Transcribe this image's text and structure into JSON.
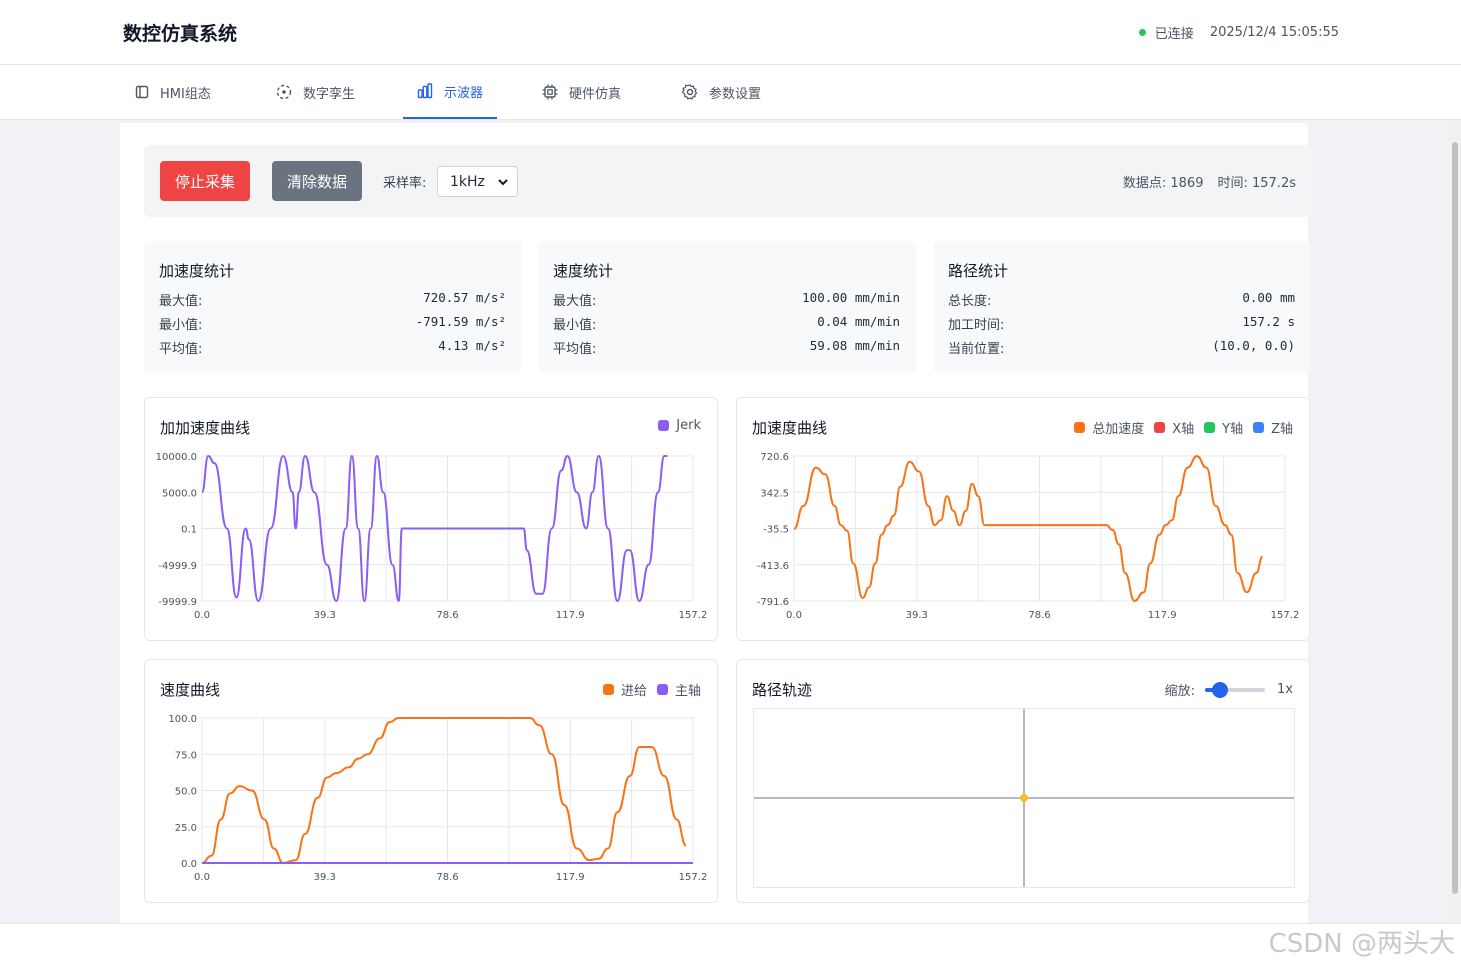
{
  "app": {
    "title": "数控仿真系统",
    "status_text": "已连接",
    "datetime": "2025/12/4 15:05:55",
    "status_color": "#22c55e"
  },
  "tabs": [
    {
      "label": "HMI组态",
      "icon": "panel-icon",
      "active": false
    },
    {
      "label": "数字孪生",
      "icon": "twin-icon",
      "active": false
    },
    {
      "label": "示波器",
      "icon": "bar-chart-icon",
      "active": true
    },
    {
      "label": "硬件仿真",
      "icon": "chip-icon",
      "active": false
    },
    {
      "label": "参数设置",
      "icon": "gear-icon",
      "active": false
    }
  ],
  "toolbar": {
    "stop_label": "停止采集",
    "clear_label": "清除数据",
    "rate_label": "采样率:",
    "rate_value": "1kHz",
    "points_text": "数据点: 1869",
    "time_text": "时间: 157.2s"
  },
  "stats": {
    "accel": {
      "title": "加速度统计",
      "rows": [
        {
          "label": "最大值:",
          "value": "720.57 m/s²"
        },
        {
          "label": "最小值:",
          "value": "-791.59 m/s²"
        },
        {
          "label": "平均值:",
          "value": "4.13 m/s²"
        }
      ]
    },
    "speed": {
      "title": "速度统计",
      "rows": [
        {
          "label": "最大值:",
          "value": "100.00 mm/min"
        },
        {
          "label": "最小值:",
          "value": "0.04 mm/min"
        },
        {
          "label": "平均值:",
          "value": "59.08 mm/min"
        }
      ]
    },
    "path": {
      "title": "路径统计",
      "rows": [
        {
          "label": "总长度:",
          "value": "0.00 mm"
        },
        {
          "label": "加工时间:",
          "value": "157.2 s"
        },
        {
          "label": "当前位置:",
          "value": "(10.0, 0.0)"
        }
      ]
    }
  },
  "path_panel": {
    "title": "路径轨迹",
    "zoom_label": "缩放:",
    "zoom_value": "1x",
    "zoom_level": 0.25,
    "point_color": "#fbbf24"
  },
  "watermark": "CSDN @两头大",
  "chart_data": [
    {
      "title": "加加速度曲线",
      "type": "line",
      "xticks": [
        "0.0",
        "39.3",
        "78.6",
        "117.9",
        "157.2"
      ],
      "yticks": [
        "10000.0",
        "5000.0",
        "0.1",
        "-4999.9",
        "-9999.9"
      ],
      "xlim": [
        0,
        157.2
      ],
      "ylim": [
        -9999.9,
        10000.0
      ],
      "series": [
        {
          "name": "Jerk",
          "color": "#8b5cf6",
          "points": [
            [
              0,
              5000
            ],
            [
              2,
              10000
            ],
            [
              4,
              9000
            ],
            [
              8,
              0
            ],
            [
              11,
              -9500
            ],
            [
              14,
              0
            ],
            [
              15,
              -1500
            ],
            [
              18,
              -9999
            ],
            [
              22,
              0
            ],
            [
              26,
              10000
            ],
            [
              29,
              5000
            ],
            [
              30,
              0
            ],
            [
              31,
              5000
            ],
            [
              33,
              10000
            ],
            [
              36,
              5000
            ],
            [
              40,
              -5000
            ],
            [
              43,
              -9999
            ],
            [
              46,
              0
            ],
            [
              48,
              10000
            ],
            [
              50,
              0
            ],
            [
              52,
              -9999
            ],
            [
              54,
              0
            ],
            [
              56,
              10000
            ],
            [
              58,
              5000
            ],
            [
              61,
              -5000
            ],
            [
              63,
              -9999
            ],
            [
              64,
              0
            ],
            [
              64.5,
              0
            ],
            [
              103,
              0
            ],
            [
              104,
              -3000
            ],
            [
              107,
              -9000
            ],
            [
              109,
              -9000
            ],
            [
              112,
              0
            ],
            [
              115,
              8000
            ],
            [
              117,
              10000
            ],
            [
              120,
              5000
            ],
            [
              123,
              0
            ],
            [
              125,
              5000
            ],
            [
              127,
              10000
            ],
            [
              130,
              0
            ],
            [
              133,
              -9999
            ],
            [
              136,
              -3000
            ],
            [
              137,
              -3000
            ],
            [
              140,
              -9999
            ],
            [
              143,
              -5000
            ],
            [
              146,
              5000
            ],
            [
              148,
              9999
            ],
            [
              149,
              9999
            ]
          ]
        }
      ]
    },
    {
      "title": "加速度曲线",
      "type": "line",
      "xticks": [
        "0.0",
        "39.3",
        "78.6",
        "117.9",
        "157.2"
      ],
      "yticks": [
        "720.6",
        "342.5",
        "-35.5",
        "-413.6",
        "-791.6"
      ],
      "xlim": [
        0,
        157.2
      ],
      "ylim": [
        -791.6,
        720.6
      ],
      "series": [
        {
          "name": "总加速度",
          "color": "#f97316",
          "points": [
            [
              0,
              -40
            ],
            [
              3,
              200
            ],
            [
              7,
              600
            ],
            [
              10,
              530
            ],
            [
              13,
              200
            ],
            [
              15,
              0
            ],
            [
              17,
              -60
            ],
            [
              19,
              -400
            ],
            [
              22,
              -760
            ],
            [
              24,
              -650
            ],
            [
              26,
              -400
            ],
            [
              28,
              -100
            ],
            [
              30,
              0
            ],
            [
              32,
              100
            ],
            [
              34,
              400
            ],
            [
              37,
              660
            ],
            [
              40,
              560
            ],
            [
              43,
              200
            ],
            [
              45,
              0
            ],
            [
              47,
              50
            ],
            [
              49,
              300
            ],
            [
              51,
              150
            ],
            [
              53,
              0
            ],
            [
              55,
              150
            ],
            [
              57,
              430
            ],
            [
              59,
              300
            ],
            [
              61,
              0
            ],
            [
              62,
              0
            ],
            [
              100,
              0
            ],
            [
              102,
              -50
            ],
            [
              104,
              -200
            ],
            [
              106,
              -500
            ],
            [
              109,
              -791
            ],
            [
              112,
              -700
            ],
            [
              114,
              -400
            ],
            [
              117,
              -100
            ],
            [
              119,
              0
            ],
            [
              121,
              50
            ],
            [
              123,
              300
            ],
            [
              126,
              600
            ],
            [
              129,
              720
            ],
            [
              132,
              600
            ],
            [
              135,
              200
            ],
            [
              138,
              0
            ],
            [
              140,
              -100
            ],
            [
              142,
              -500
            ],
            [
              145,
              -700
            ],
            [
              148,
              -500
            ],
            [
              150,
              -330
            ]
          ]
        }
      ],
      "legend": [
        {
          "name": "总加速度",
          "color": "#f97316"
        },
        {
          "name": "X轴",
          "color": "#ef4444"
        },
        {
          "name": "Y轴",
          "color": "#22c55e"
        },
        {
          "name": "Z轴",
          "color": "#3b82f6"
        }
      ]
    },
    {
      "title": "速度曲线",
      "type": "line",
      "xticks": [
        "0.0",
        "39.3",
        "78.6",
        "117.9",
        "157.2"
      ],
      "yticks": [
        "100.0",
        "75.0",
        "50.0",
        "25.0",
        "0.0"
      ],
      "xlim": [
        0,
        157.2
      ],
      "ylim": [
        0,
        100
      ],
      "series": [
        {
          "name": "进给",
          "color": "#f97316",
          "points": [
            [
              0,
              0
            ],
            [
              3,
              5
            ],
            [
              6,
              30
            ],
            [
              9,
              48
            ],
            [
              12,
              53
            ],
            [
              16,
              50
            ],
            [
              20,
              30
            ],
            [
              23,
              10
            ],
            [
              26,
              0
            ],
            [
              30,
              2
            ],
            [
              33,
              20
            ],
            [
              37,
              45
            ],
            [
              40,
              59
            ],
            [
              43,
              62
            ],
            [
              47,
              66
            ],
            [
              50,
              72
            ],
            [
              53,
              75
            ],
            [
              57,
              86
            ],
            [
              60,
              97
            ],
            [
              63,
              100
            ],
            [
              105,
              100
            ],
            [
              108,
              95
            ],
            [
              112,
              75
            ],
            [
              116,
              40
            ],
            [
              120,
              10
            ],
            [
              124,
              2
            ],
            [
              127,
              3
            ],
            [
              130,
              10
            ],
            [
              133,
              35
            ],
            [
              137,
              60
            ],
            [
              140,
              80
            ],
            [
              144,
              80
            ],
            [
              148,
              60
            ],
            [
              152,
              30
            ],
            [
              155,
              12
            ]
          ]
        },
        {
          "name": "主轴",
          "color": "#8b5cf6",
          "points": [
            [
              0,
              0
            ],
            [
              157.2,
              0
            ]
          ]
        }
      ]
    }
  ]
}
